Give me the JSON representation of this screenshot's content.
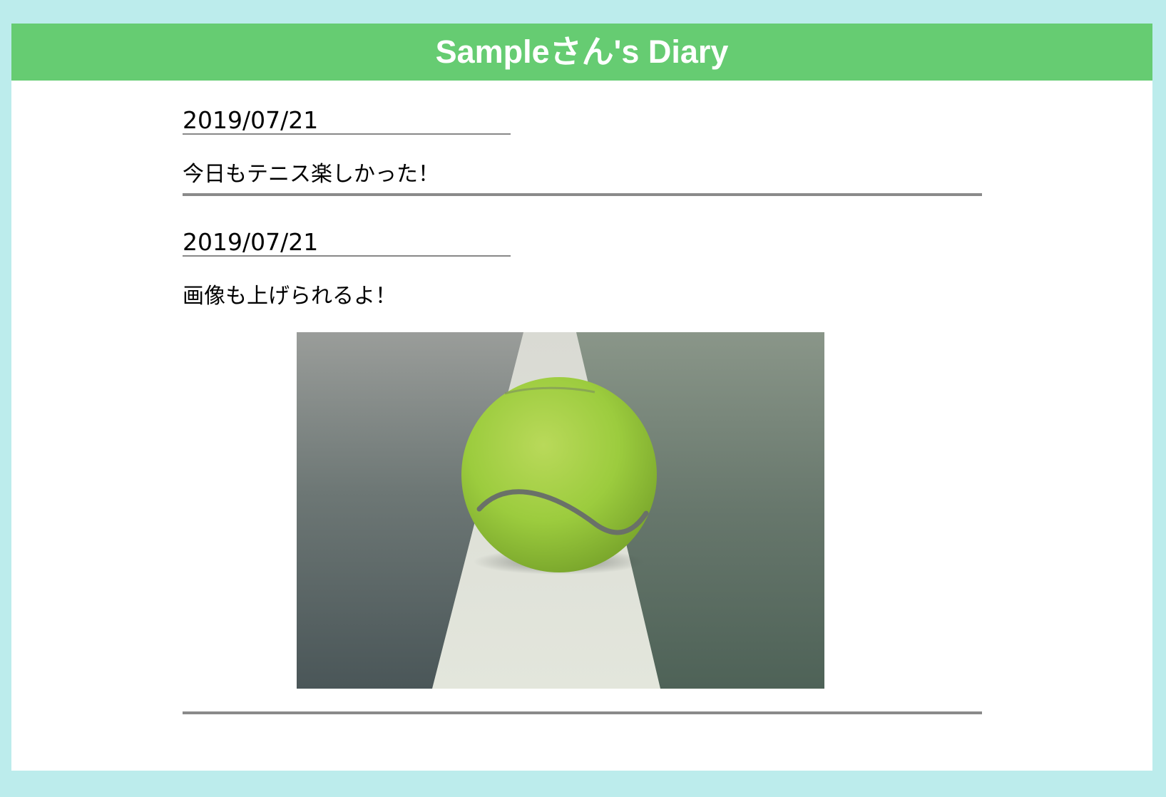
{
  "header": {
    "title": "Sampleさん's Diary"
  },
  "entries": [
    {
      "date": "2019/07/21",
      "text": "今日もテニス楽しかった！"
    },
    {
      "date": "2019/07/21",
      "text": "画像も上げられるよ！",
      "image": {
        "subject": "tennis-ball-on-court-line-photo"
      }
    }
  ],
  "colors": {
    "page_background": "#bcecec",
    "header_background": "#66cc72",
    "header_text": "#ffffff",
    "divider": "#8a8a8a"
  }
}
